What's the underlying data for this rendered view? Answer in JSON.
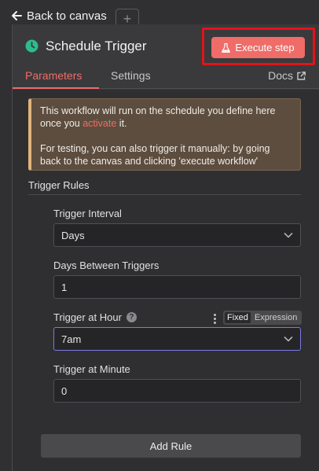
{
  "canvas": {
    "back_label": "Back to canvas",
    "ghost_text": "...",
    "ghost_plus": "+"
  },
  "node": {
    "title": "Schedule Trigger",
    "execute_label": "Execute step",
    "icon": "clock-icon",
    "accent_color": "#ef6c68"
  },
  "tabs": {
    "parameters": "Parameters",
    "settings": "Settings",
    "docs": "Docs"
  },
  "notice": {
    "line1_pre": "This workflow will run on the schedule you define here once you ",
    "line1_link": "activate",
    "line1_post": " it.",
    "line2": "For testing, you can also trigger it manually: by going back to the canvas and clicking 'execute workflow'"
  },
  "rules": {
    "section_title": "Trigger Rules",
    "interval_label": "Trigger Interval",
    "interval_value": "Days",
    "days_between_label": "Days Between Triggers",
    "days_between_value": "1",
    "hour_label": "Trigger at Hour",
    "hour_value": "7am",
    "hour_mode_fixed": "Fixed",
    "hour_mode_expression": "Expression",
    "minute_label": "Trigger at Minute",
    "minute_value": "0",
    "add_rule_label": "Add Rule"
  }
}
